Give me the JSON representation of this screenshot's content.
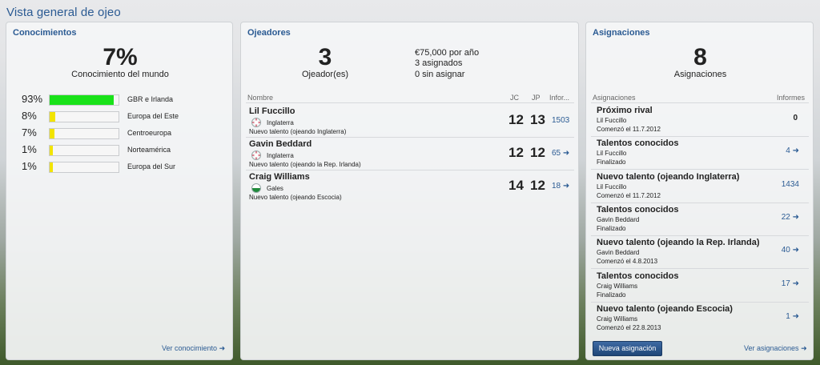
{
  "page": {
    "title": "Vista general de ojeo"
  },
  "knowledge": {
    "title": "Conocimientos",
    "percent": "7%",
    "subtitle": "Conocimiento del mundo",
    "rows": [
      {
        "pct": "93%",
        "value": 0.93,
        "region": "GBR e Irlanda",
        "color": "#19e219"
      },
      {
        "pct": "8%",
        "value": 0.08,
        "region": "Europa del Este",
        "color": "#f2e400"
      },
      {
        "pct": "7%",
        "value": 0.07,
        "region": "Centroeuropa",
        "color": "#f2e400"
      },
      {
        "pct": "1%",
        "value": 0.01,
        "region": "Norteamérica",
        "color": "#f2e400"
      },
      {
        "pct": "1%",
        "value": 0.01,
        "region": "Europa del Sur",
        "color": "#f2e400"
      }
    ],
    "link": "Ver conocimiento"
  },
  "scouts": {
    "title": "Ojeadores",
    "count": "3",
    "count_label": "Ojeador(es)",
    "budget": "€75,000 por año",
    "assigned": "3 asignados",
    "unassigned": "0 sin asignar",
    "headers": {
      "name": "Nombre",
      "jc": "JC",
      "jp": "JP",
      "reports": "Infor..."
    },
    "rows": [
      {
        "name": "Lil Fuccillo",
        "nation": "Inglaterra",
        "flag": "england-flag-icon",
        "desc": "Nuevo talento (ojeando Inglaterra)",
        "jc": "12",
        "jp": "13",
        "reports": "1503"
      },
      {
        "name": "Gavin Beddard",
        "nation": "Inglaterra",
        "flag": "england-flag-icon",
        "desc": "Nuevo talento (ojeando la Rep. Irlanda)",
        "jc": "12",
        "jp": "12",
        "reports": "65 ➜"
      },
      {
        "name": "Craig Williams",
        "nation": "Gales",
        "flag": "wales-flag-icon",
        "desc": "Nuevo talento (ojeando Escocia)",
        "jc": "14",
        "jp": "12",
        "reports": "18 ➜"
      }
    ]
  },
  "assignments": {
    "title": "Asignaciones",
    "count": "8",
    "count_label": "Asignaciones",
    "headers": {
      "name": "Asignaciones",
      "reports": "Informes"
    },
    "rows": [
      {
        "title": "Próximo rival",
        "scout": "Lil Fuccillo",
        "status": "Comenzó el 11.7.2012",
        "count": "0"
      },
      {
        "title": "Talentos conocidos",
        "scout": "Lil Fuccillo",
        "status": "Finalizado",
        "count": "4 ➜"
      },
      {
        "title": "Nuevo talento (ojeando Inglaterra)",
        "scout": "Lil Fuccillo",
        "status": "Comenzó el 11.7.2012",
        "count": "1434"
      },
      {
        "title": "Talentos conocidos",
        "scout": "Gavin Beddard",
        "status": "Finalizado",
        "count": "22 ➜"
      },
      {
        "title": "Nuevo talento (ojeando la Rep. Irlanda)",
        "scout": "Gavin Beddard",
        "status": "Comenzó el 4.8.2013",
        "count": "40 ➜"
      },
      {
        "title": "Talentos conocidos",
        "scout": "Craig Williams",
        "status": "Finalizado",
        "count": "17 ➜"
      },
      {
        "title": "Nuevo talento (ojeando Escocia)",
        "scout": "Craig Williams",
        "status": "Comenzó el 22.8.2013",
        "count": "1 ➜"
      }
    ],
    "new_button": "Nueva asignación",
    "link": "Ver asignaciones"
  }
}
